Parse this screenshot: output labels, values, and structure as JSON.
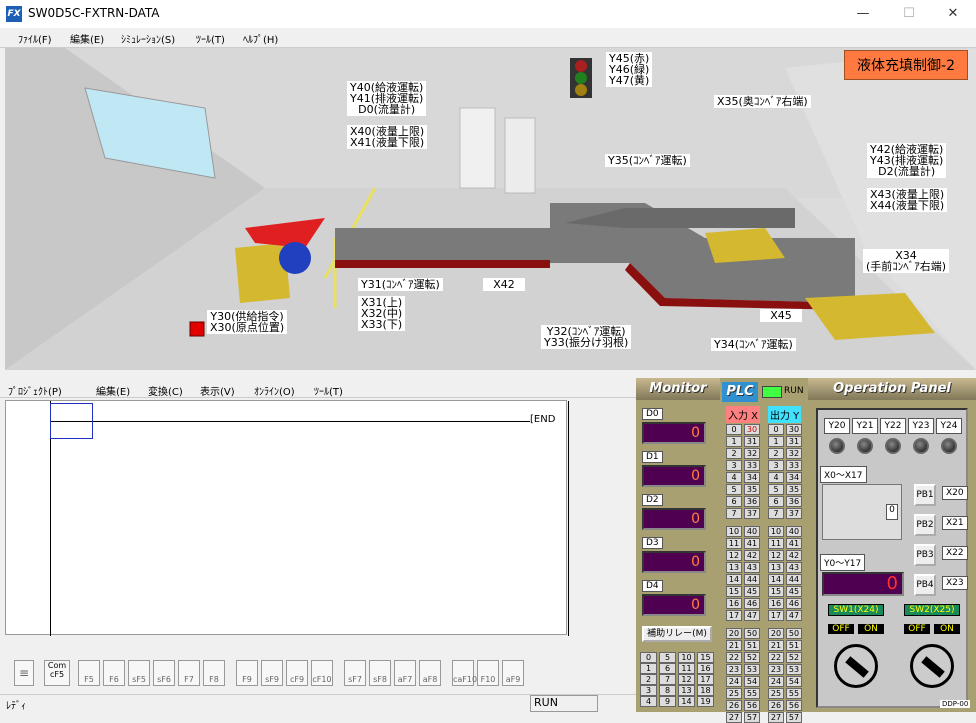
{
  "window": {
    "title": "SW0D5C-FXTRN-DATA",
    "icon": "FX",
    "min": "—",
    "max": "☐",
    "close": "✕"
  },
  "menu": [
    "ﾌｧｲﾙ(F)",
    "編集(E)",
    "ｼﾐｭﾚｰｼｮﾝ(S)",
    "ﾂｰﾙ(T)",
    "ﾍﾙﾌﾟ(H)"
  ],
  "scene": {
    "title": "液体充填制御-2",
    "labels": [
      "Y45(赤)\nY46(緑)\nY47(黄)",
      "Y40(給液運転)\nY41(排液運転)\nD0(流量計)",
      "X40(液量上限)\nX41(液量下限)",
      "X35(奥ｺﾝﾍﾞｱ右端)",
      "Y35(ｺﾝﾍﾞｱ運転)",
      "Y42(給液運転)\nY43(排液運転)\nD2(流量計)",
      "X43(液量上限)\nX44(液量下限)",
      "X34\n(手前ｺﾝﾍﾞｱ右端)",
      "Y31(ｺﾝﾍﾞｱ運転)",
      "X42",
      "X31(上)\nX32(中)\nX33(下)",
      "Y30(供給指令)\nX30(原点位置)",
      "Y32(ｺﾝﾍﾞｱ運転)\nY33(振分け羽根)",
      "X45",
      "Y34(ｺﾝﾍﾞｱ運転)"
    ]
  },
  "editor": {
    "menu": [
      "ﾌﾟﾛｼﾞｪｸﾄ(P)",
      "編集(E)",
      "変換(C)",
      "表示(V)",
      "ｵﾝﾗｲﾝ(O)",
      "ﾂｰﾙ(T)"
    ],
    "end_label": "[END",
    "fkeys": [
      "Com\ncF5",
      "F5",
      "F6",
      "sF5",
      "sF6",
      "F7",
      "F8",
      "F9",
      "sF9",
      "cF9",
      "cF10",
      "sF7",
      "sF8",
      "aF7",
      "aF8",
      "caF10",
      "F10",
      "aF9"
    ],
    "status_left": "ﾚﾃﾞｨ",
    "status_run": "RUN"
  },
  "monitor": {
    "title": "Monitor",
    "regs": [
      {
        "name": "D0",
        "value": "0"
      },
      {
        "name": "D1",
        "value": "0"
      },
      {
        "name": "D2",
        "value": "0"
      },
      {
        "name": "D3",
        "value": "0"
      },
      {
        "name": "D4",
        "value": "0"
      }
    ],
    "aux_button": "補助リレー(M)"
  },
  "plc": {
    "title": "PLC",
    "run": "RUN",
    "in_label": "入力 X",
    "out_label": "出力 Y"
  },
  "op": {
    "title": "Operation Panel",
    "y_lamps": [
      "Y20",
      "Y21",
      "Y22",
      "Y23",
      "Y24"
    ],
    "x_range": "X0～X17",
    "y_range": "Y0～Y17",
    "digit": "0",
    "seg_value": "0",
    "pbs": [
      {
        "label": "PB1",
        "x": "X20"
      },
      {
        "label": "PB2",
        "x": "X21"
      },
      {
        "label": "PB3",
        "x": "X22"
      },
      {
        "label": "PB4",
        "x": "X23"
      }
    ],
    "sw1": "SW1(X24)",
    "sw2": "SW2(X25)",
    "off": "OFF",
    "on": "ON",
    "footer": "DDP-00"
  }
}
